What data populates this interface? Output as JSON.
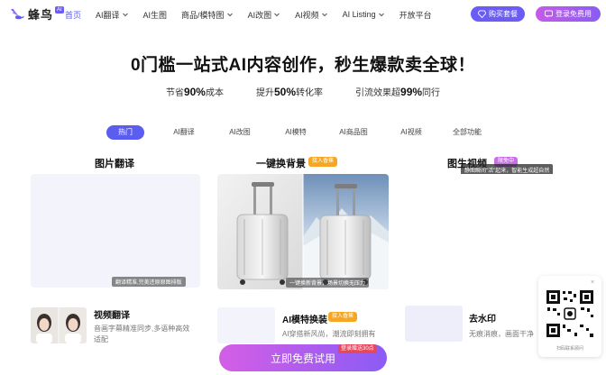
{
  "header": {
    "logo_text": "蜂鸟",
    "logo_badge": "AI",
    "nav": [
      {
        "label": "首页",
        "active": true,
        "dropdown": false
      },
      {
        "label": "AI翻译",
        "active": false,
        "dropdown": true
      },
      {
        "label": "AI生图",
        "active": false,
        "dropdown": false
      },
      {
        "label": "商品/模特图",
        "active": false,
        "dropdown": true
      },
      {
        "label": "AI改图",
        "active": false,
        "dropdown": true
      },
      {
        "label": "AI视频",
        "active": false,
        "dropdown": true
      },
      {
        "label": "AI Listing",
        "active": false,
        "dropdown": true
      },
      {
        "label": "开放平台",
        "active": false,
        "dropdown": false
      }
    ],
    "buy_button": "购买套餐",
    "login_button": "登录免费用"
  },
  "hero": {
    "title": "0门槛一站式AI内容创作，秒生爆款卖全球！",
    "stats": [
      {
        "prefix": "节省",
        "value": "90%",
        "suffix": "成本"
      },
      {
        "prefix": "提升",
        "value": "50%",
        "suffix": "转化率"
      },
      {
        "prefix": "引流效果超",
        "value": "99%",
        "suffix": "同行"
      }
    ]
  },
  "tabs": [
    "热门",
    "AI翻译",
    "AI改图",
    "AI模特",
    "AI商品图",
    "AI视频",
    "全部功能"
  ],
  "cards": {
    "image_translate": {
      "title": "图片翻译",
      "caption": "翻译精准,完美还原原图排版"
    },
    "background_swap": {
      "title": "一键换背景",
      "tag": "接入香蕉",
      "caption": "一键换新背景，场景切换无压力"
    },
    "image_video": {
      "title": "图生视频",
      "tag": "限免中",
      "tooltip": "静图瞬间\"活\"起来，智能生成超自然"
    }
  },
  "row2": {
    "video_translate": {
      "title": "视频翻译",
      "desc_line1": "音画字幕精准同步,多语种高效",
      "desc_line2": "适配"
    },
    "model_swap": {
      "title": "AI模特换装",
      "tag": "接入香蕉",
      "desc": "AI穿搭新风尚，潮流即刻拥有"
    },
    "watermark": {
      "title": "去水印",
      "desc": "无痕消痕，画面干净"
    }
  },
  "cta": {
    "label": "立即免费试用",
    "badge": "登录赠送30点"
  },
  "qr": {
    "caption": "扫码联系顾问",
    "close": "×"
  },
  "colors": {
    "accent": "#5b5cf0",
    "gradient_start": "#d45ee6",
    "gradient_end": "#8b5cf5",
    "tag_orange": "#f6a623"
  }
}
